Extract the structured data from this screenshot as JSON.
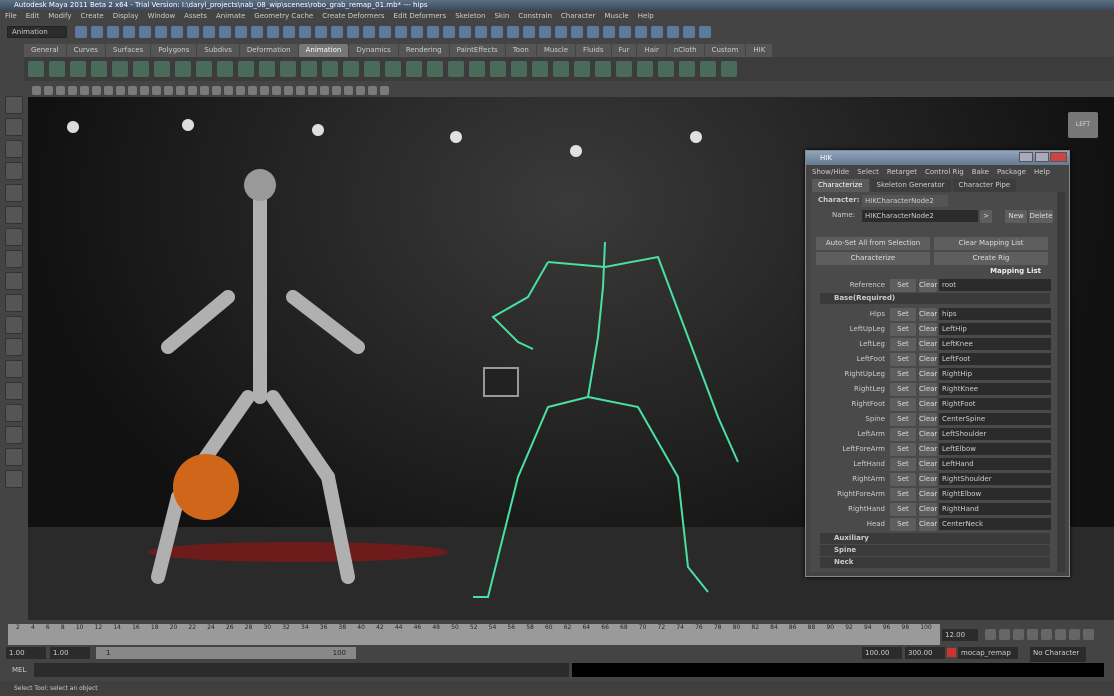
{
  "title": "Autodesk Maya 2011 Beta 2 x64 - Trial Version: I:\\daryl_projects\\nab_08_wip\\scenes\\robo_grab_remap_01.mb*  ---  hips",
  "menu": [
    "File",
    "Edit",
    "Modify",
    "Create",
    "Display",
    "Window",
    "Assets",
    "Animate",
    "Geometry Cache",
    "Create Deformers",
    "Edit Deformers",
    "Skeleton",
    "Skin",
    "Constrain",
    "Character",
    "Muscle",
    "Help"
  ],
  "menu_set": "Animation",
  "shelf_tabs": [
    "General",
    "Curves",
    "Surfaces",
    "Polygons",
    "Subdivs",
    "Deformation",
    "Animation",
    "Dynamics",
    "Rendering",
    "PaintEffects",
    "Toon",
    "Muscle",
    "Fluids",
    "Fur",
    "Hair",
    "nCloth",
    "Custom",
    "HIK"
  ],
  "active_shelf": "Animation",
  "viewcube_label": "LEFT",
  "hik": {
    "title": "HIK",
    "menu": [
      "Show/Hide",
      "Select",
      "Retarget",
      "Control Rig",
      "Bake",
      "Package",
      "Help"
    ],
    "tabs": [
      "Characterize",
      "Skeleton Generator",
      "Character Pipe"
    ],
    "character_label": "Character:",
    "character_value": "HIKCharacterNode2",
    "name_label": "Name:",
    "name_value": "HIKCharacterNode2",
    "arrow_btn": ">",
    "new_btn": "New",
    "delete_btn": "Delete",
    "auto_set": "Auto-Set All from Selection",
    "clear_mapping": "Clear Mapping List",
    "characterize": "Characterize",
    "create_rig": "Create Rig",
    "mapping_list": "Mapping List",
    "reference": {
      "label": "Reference",
      "value": "root"
    },
    "set": "Set",
    "clear": "Clear",
    "base_section": "Base(Required)",
    "rows": [
      {
        "label": "Hips",
        "value": "hips"
      },
      {
        "label": "LeftUpLeg",
        "value": "LeftHip"
      },
      {
        "label": "LeftLeg",
        "value": "LeftKnee"
      },
      {
        "label": "LeftFoot",
        "value": "LeftFoot"
      },
      {
        "label": "RightUpLeg",
        "value": "RightHip"
      },
      {
        "label": "RightLeg",
        "value": "RightKnee"
      },
      {
        "label": "RightFoot",
        "value": "RightFoot"
      },
      {
        "label": "Spine",
        "value": "CenterSpine"
      },
      {
        "label": "LeftArm",
        "value": "LeftShoulder"
      },
      {
        "label": "LeftForeArm",
        "value": "LeftElbow"
      },
      {
        "label": "LeftHand",
        "value": "LeftHand"
      },
      {
        "label": "RightArm",
        "value": "RightShoulder"
      },
      {
        "label": "RightForeArm",
        "value": "RightElbow"
      },
      {
        "label": "RightHand",
        "value": "RightHand"
      },
      {
        "label": "Head",
        "value": "CenterNeck"
      }
    ],
    "sections": [
      "Auxiliary",
      "Spine",
      "Neck"
    ]
  },
  "timeline": {
    "ticks": [
      "2",
      "4",
      "6",
      "8",
      "10",
      "12",
      "14",
      "16",
      "18",
      "20",
      "22",
      "24",
      "26",
      "28",
      "30",
      "32",
      "34",
      "36",
      "38",
      "40",
      "42",
      "44",
      "46",
      "48",
      "50",
      "52",
      "54",
      "56",
      "58",
      "60",
      "62",
      "64",
      "66",
      "68",
      "70",
      "72",
      "74",
      "76",
      "78",
      "80",
      "82",
      "84",
      "86",
      "88",
      "90",
      "92",
      "94",
      "96",
      "98",
      "100"
    ],
    "current": "12.00"
  },
  "range": {
    "start": "1.00",
    "playback_start": "1.00",
    "slider_start": "1",
    "slider_end": "100",
    "playback_end": "100.00",
    "end": "300.00",
    "anim_layer": "mocap_remap",
    "character_set": "No Character Set"
  },
  "mel_label": "MEL",
  "help_line": "Select Tool: select an object"
}
